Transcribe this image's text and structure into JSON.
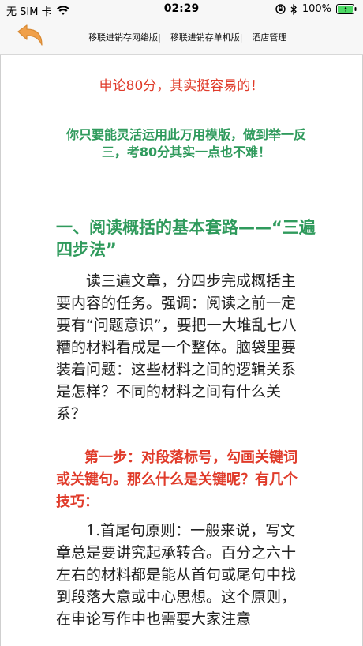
{
  "status_bar": {
    "carrier": "无 SIM 卡",
    "time": "02:29",
    "battery_percent": "100%"
  },
  "nav": {
    "links": [
      "移联进销存网络版|",
      "移联进销存单机版|",
      "酒店管理"
    ]
  },
  "article": {
    "headline_red": "申论80分，其实挺容易的！",
    "headline_green": "你只要能灵活运用此万用模版，做到举一反三，考80分其实一点也不难！",
    "section_title": "一、阅读概括的基本套路——“三遍四步法”",
    "paragraph1": "读三遍文章，分四步完成概括主要内容的任务。强调：阅读之前一定要有“问题意识”，要把一大堆乱七八糟的材料看成是一个整体。脑袋里要装着问题：这些材料之间的逻辑关系是怎样？不同的材料之间有什么关系？",
    "step1": "第一步：对段落标号，勾画关键词或关键句。那么什么是关键呢？有几个技巧：",
    "paragraph3": "1.首尾句原则：一般来说，写文章总是要讲究起承转合。百分之六十左右的材料都是能从首句或尾句中找到段落大意或中心思想。这个原则，在申论写作中也需要大家注意"
  },
  "colors": {
    "red": "#e03b2a",
    "green": "#2f9a5c",
    "back_arrow": "#f0a04a"
  }
}
